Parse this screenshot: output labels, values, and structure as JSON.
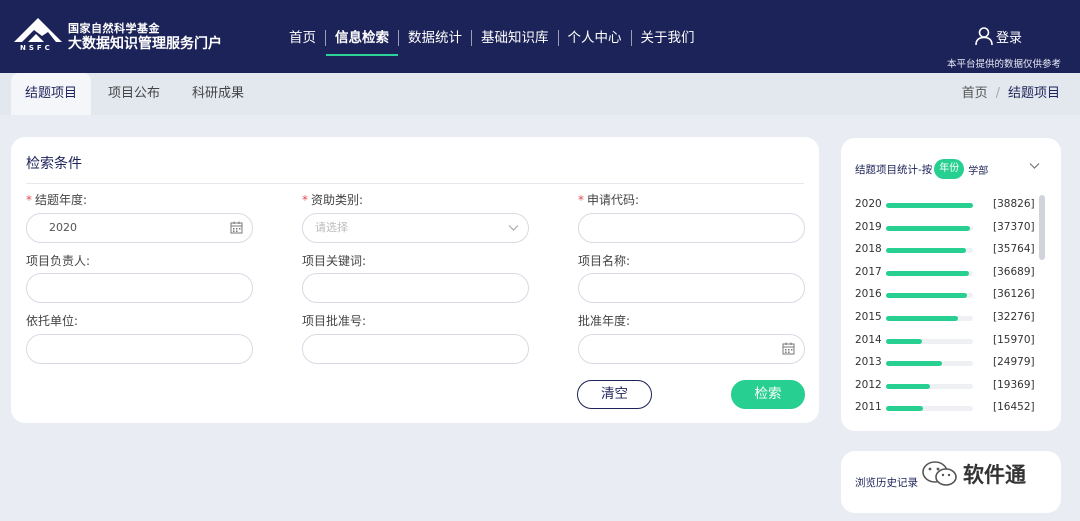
{
  "header": {
    "logo_line1": "国家自然科学基金",
    "logo_line2": "大数据知识管理服务门户",
    "logo_badge": "NSFC",
    "nav": [
      "首页",
      "信息检索",
      "数据统计",
      "基础知识库",
      "个人中心",
      "关于我们"
    ],
    "login_label": "登录",
    "notice": "本平台提供的数据仅供参考"
  },
  "subnav": {
    "tabs": [
      "结题项目",
      "项目公布",
      "科研成果"
    ],
    "breadcrumb": [
      "首页",
      "结题项目"
    ]
  },
  "search": {
    "title": "检索条件",
    "fields": {
      "year": {
        "label": "结题年度:",
        "value": "2020",
        "required": true
      },
      "funding": {
        "label": "资助类别:",
        "placeholder": "请选择",
        "required": true
      },
      "code": {
        "label": "申请代码:",
        "value": "",
        "required": true
      },
      "leader": {
        "label": "项目负责人:",
        "value": ""
      },
      "keyword": {
        "label": "项目关键词:",
        "value": ""
      },
      "name": {
        "label": "项目名称:",
        "value": ""
      },
      "org": {
        "label": "依托单位:",
        "value": ""
      },
      "approval": {
        "label": "项目批准号:",
        "value": ""
      },
      "approval_year": {
        "label": "批准年度:",
        "value": ""
      }
    },
    "clear_label": "清空",
    "search_label": "检索"
  },
  "stats": {
    "title": "结题项目统计-按",
    "filters": [
      "年份",
      "学部"
    ],
    "rows": [
      {
        "year": "2020",
        "count": "[38826]",
        "ratio": 1.0
      },
      {
        "year": "2019",
        "count": "[37370]",
        "ratio": 0.96
      },
      {
        "year": "2018",
        "count": "[35764]",
        "ratio": 0.92
      },
      {
        "year": "2017",
        "count": "[36689]",
        "ratio": 0.95
      },
      {
        "year": "2016",
        "count": "[36126]",
        "ratio": 0.93
      },
      {
        "year": "2015",
        "count": "[32276]",
        "ratio": 0.83
      },
      {
        "year": "2014",
        "count": "[15970]",
        "ratio": 0.41
      },
      {
        "year": "2013",
        "count": "[24979]",
        "ratio": 0.64
      },
      {
        "year": "2012",
        "count": "[19369]",
        "ratio": 0.5
      },
      {
        "year": "2011",
        "count": "[16452]",
        "ratio": 0.42
      }
    ]
  },
  "history": {
    "label": "浏览历史记录"
  },
  "watermark": {
    "text": "软件通"
  },
  "colors": {
    "header_bg": "#1c2358",
    "accent": "#27cf91",
    "page_bg": "#e9edf3"
  }
}
